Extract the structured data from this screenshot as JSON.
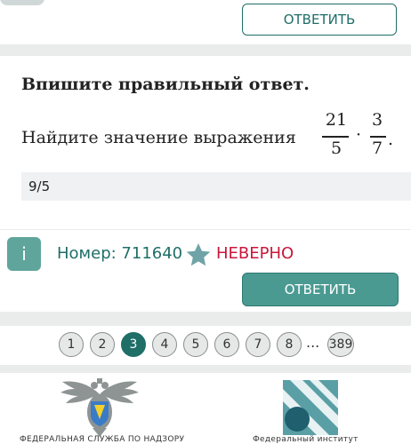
{
  "top_card": {
    "answer_button_label": "ОТВЕТИТЬ"
  },
  "task": {
    "instruction": "Впишите правильный ответ.",
    "question_text": "Найдите значение выражения",
    "fraction1": {
      "numerator": "21",
      "denominator": "5"
    },
    "operator": "·",
    "fraction2": {
      "numerator": "3",
      "denominator": "7"
    },
    "end_punct": ".",
    "answer_value": "9/5"
  },
  "result": {
    "info_badge": "i",
    "number_label": "Номер: 711640",
    "verdict": "НЕВЕРНО",
    "answer_button_label": "ОТВЕТИТЬ"
  },
  "pagination": {
    "pages": [
      "1",
      "2",
      "3",
      "4",
      "5",
      "6",
      "7",
      "8"
    ],
    "active": "3",
    "ellipsis": "...",
    "last_page": "389"
  },
  "footer": {
    "left_text": "ФЕДЕРАЛЬНАЯ СЛУЖБА ПО НАДЗОРУ",
    "right_text": "Федеральный институт"
  },
  "colors": {
    "accent": "#1f6e68",
    "button_fill": "#4a9a92",
    "error": "#c8173b",
    "star": "#6fa3a8"
  },
  "icons": [
    "star-icon",
    "info-icon",
    "emblem-icon",
    "fipi-logo-icon"
  ]
}
